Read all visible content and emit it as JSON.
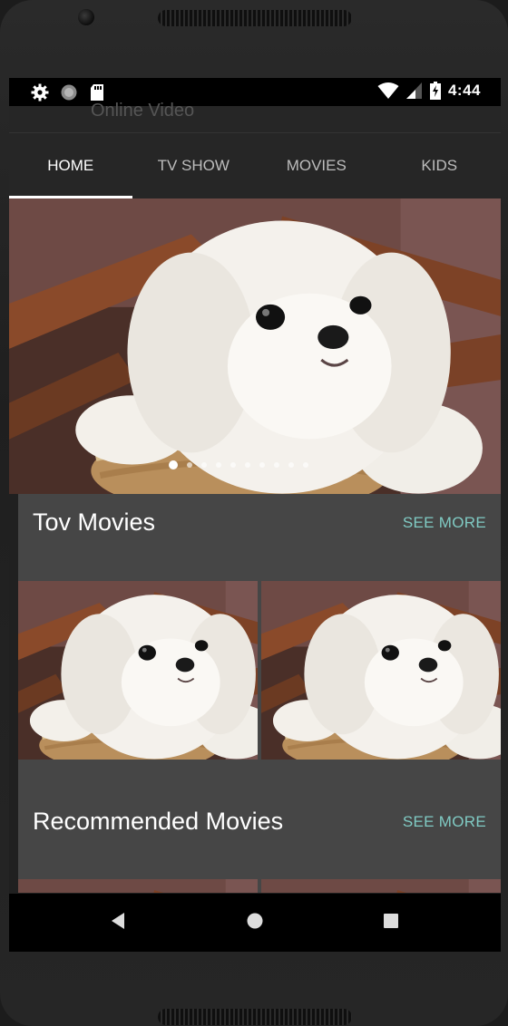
{
  "app": {
    "title": "Online Video"
  },
  "status_bar": {
    "time": "4:44",
    "icons_left": [
      "settings-icon",
      "sync-icon",
      "sd-card-icon"
    ],
    "icons_right": [
      "wifi-icon",
      "signal-icon",
      "battery-icon"
    ]
  },
  "tabs": [
    {
      "label": "HOME",
      "active": true
    },
    {
      "label": "TV SHOW",
      "active": false
    },
    {
      "label": "MOVIES",
      "active": false
    },
    {
      "label": "KIDS",
      "active": false
    }
  ],
  "banner": {
    "slide_count": 10,
    "active_index": 0
  },
  "sections": [
    {
      "title": "Tov Movies",
      "action": "SEE MORE"
    },
    {
      "title": "Recommended Movies",
      "action": "SEE MORE"
    }
  ],
  "nav_bar": {
    "buttons": [
      "back-icon",
      "home-icon",
      "recents-icon"
    ]
  },
  "colors": {
    "accent": "#80cbc4",
    "background": "#202020",
    "surface": "#464646",
    "tab_bar": "#262626"
  }
}
